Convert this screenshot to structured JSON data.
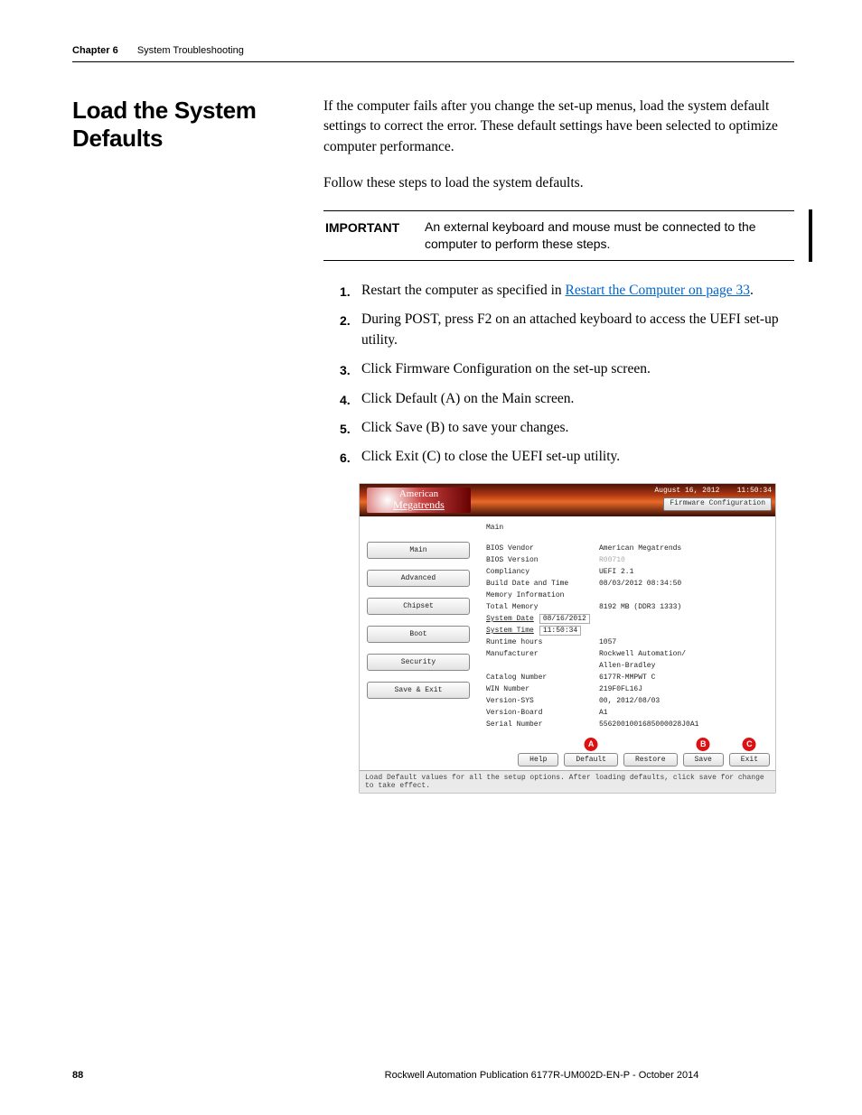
{
  "header": {
    "chapter_label": "Chapter 6",
    "chapter_title": "System Troubleshooting"
  },
  "section": {
    "title": "Load the System Defaults",
    "intro": "If the computer fails after you change the set-up menus, load the system default settings to correct the error. These default settings have been selected to optimize computer performance.",
    "follow": "Follow these steps to load the system defaults."
  },
  "important": {
    "label": "IMPORTANT",
    "text": "An external keyboard and mouse must be connected to the computer to perform these steps."
  },
  "steps": {
    "s1_a": "Restart the computer as specified in ",
    "s1_link": "Restart the Computer on page 33",
    "s1_b": ".",
    "s2": "During POST, press F2 on an attached keyboard to access the UEFI set-up utility.",
    "s3": "Click Firmware Configuration on the set-up screen.",
    "s4": "Click Default (A) on the Main screen.",
    "s5": "Click Save (B) to save your changes.",
    "s6": "Click Exit (C) to close the UEFI set-up utility."
  },
  "bios": {
    "logo_line1": "American",
    "logo_line2": "Megatrends",
    "date": "August 16, 2012",
    "time": "11:50:34",
    "fw_config": "Firmware Configuration",
    "nav": [
      "Main",
      "Advanced",
      "Chipset",
      "Boot",
      "Security",
      "Save & Exit"
    ],
    "main_title": "Main",
    "rows": [
      {
        "k": "BIOS Vendor",
        "v": "American Megatrends"
      },
      {
        "k": "BIOS Version",
        "v": "R00710",
        "gray": true
      },
      {
        "k": "Compliancy",
        "v": "UEFI 2.1"
      },
      {
        "k": "Build Date and Time",
        "v": "08/03/2012 08:34:50"
      },
      {
        "k": "Memory Information",
        "v": ""
      },
      {
        "k": "Total Memory",
        "v": "8192 MB (DDR3 1333)"
      }
    ],
    "sys_date_label": "System Date",
    "sys_date_val": "08/16/2012",
    "sys_time_label": "System Time",
    "sys_time_val": "11:50:34",
    "rows2": [
      {
        "k": "Runtime hours",
        "v": "1057"
      },
      {
        "k": "Manufacturer",
        "v": "Rockwell Automation/"
      },
      {
        "k": "",
        "v": "Allen-Bradley"
      },
      {
        "k": "Catalog Number",
        "v": "6177R-MMPWT C"
      },
      {
        "k": "WIN Number",
        "v": "219F0FL16J"
      },
      {
        "k": "Version-SYS",
        "v": "00, 2012/08/03"
      },
      {
        "k": "Version-Board",
        "v": "A1"
      },
      {
        "k": "Serial Number",
        "v": "5562001001685000028J0A1"
      }
    ],
    "buttons": {
      "help": "Help",
      "default": "Default",
      "restore": "Restore",
      "save": "Save",
      "exit": "Exit"
    },
    "callouts": {
      "a": "A",
      "b": "B",
      "c": "C"
    },
    "status": "Load Default values for all the setup options. After loading defaults, click save for change to take effect."
  },
  "footer": {
    "page": "88",
    "publication": "Rockwell Automation Publication 6177R-UM002D-EN-P - October 2014"
  }
}
